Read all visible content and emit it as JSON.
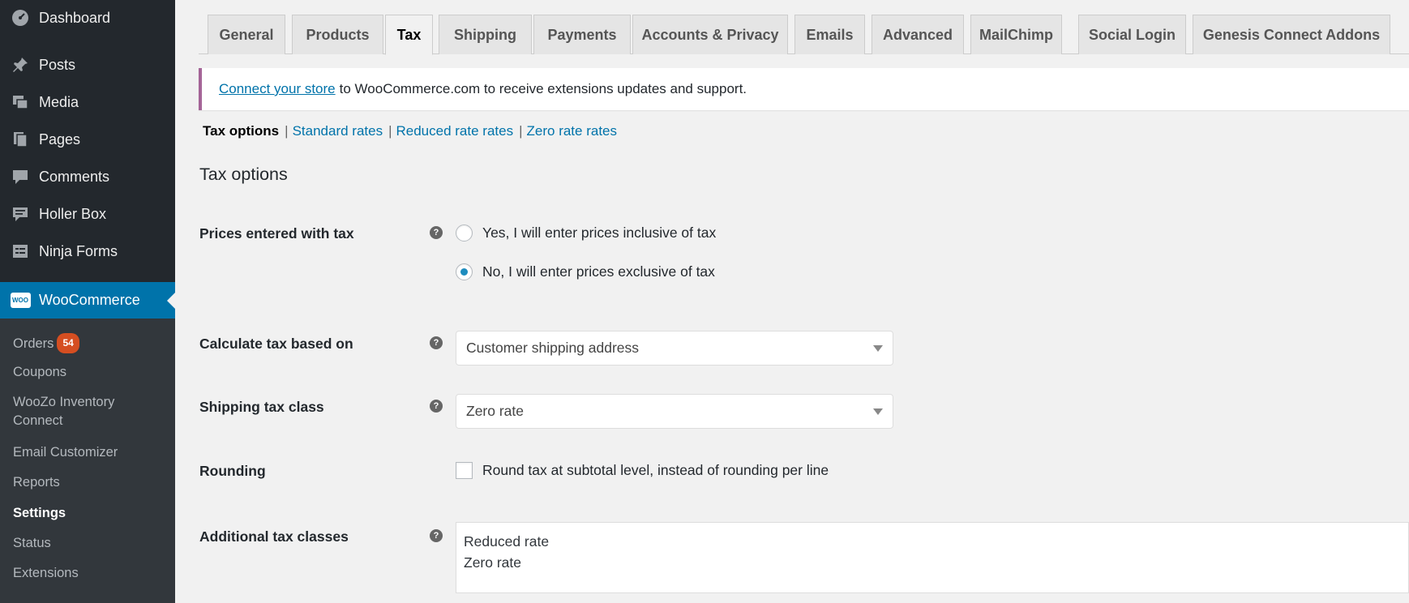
{
  "sidebar": {
    "menu": [
      {
        "label": "Dashboard",
        "icon": "dashboard-icon"
      },
      {
        "label": "Posts",
        "icon": "pin-icon"
      },
      {
        "label": "Media",
        "icon": "media-icon"
      },
      {
        "label": "Pages",
        "icon": "pages-icon"
      },
      {
        "label": "Comments",
        "icon": "comment-icon"
      },
      {
        "label": "Holler Box",
        "icon": "holler-box-icon"
      },
      {
        "label": "Ninja Forms",
        "icon": "forms-icon"
      }
    ],
    "active": {
      "label": "WooCommerce",
      "icon": "woo-icon",
      "icon_text": "WOO"
    },
    "submenu": {
      "orders": "Orders",
      "orders_badge": "54",
      "coupons": "Coupons",
      "woozo_line1": "WooZo Inventory",
      "woozo_line2": "Connect",
      "email_customizer": "Email Customizer",
      "reports": "Reports",
      "settings": "Settings",
      "status": "Status",
      "extensions": "Extensions"
    }
  },
  "tabs": [
    "General",
    "Products",
    "Tax",
    "Shipping",
    "Payments",
    "Accounts & Privacy",
    "Emails",
    "Advanced",
    "MailChimp",
    "Social Login",
    "Genesis Connect Addons"
  ],
  "active_tab": "Tax",
  "notice": {
    "link": "Connect your store",
    "text": "to WooCommerce.com to receive extensions updates and support."
  },
  "subnav": {
    "current": "Tax options",
    "sep": "|",
    "links": [
      "Standard rates",
      "Reduced rate rates",
      "Zero rate rates"
    ]
  },
  "section_title": "Tax options",
  "fields": {
    "prices_label": "Prices entered with tax",
    "prices_option_yes": "Yes, I will enter prices inclusive of tax",
    "prices_option_no": "No, I will enter prices exclusive of tax",
    "prices_selected": "no",
    "calc_label": "Calculate tax based on",
    "calc_value": "Customer shipping address",
    "shipping_label": "Shipping tax class",
    "shipping_value": "Zero rate",
    "rounding_label": "Rounding",
    "rounding_option": "Round tax at subtotal level, instead of rounding per line",
    "rounding_checked": false,
    "additional_label": "Additional tax classes",
    "additional_line1": "Reduced rate",
    "additional_line2": "Zero rate"
  },
  "help_glyph": "?",
  "colors": {
    "sidebar_bg": "#23282d",
    "submenu_bg": "#32373c",
    "accent": "#0073aa",
    "badge": "#d54e21",
    "notice_border": "#a46497"
  }
}
